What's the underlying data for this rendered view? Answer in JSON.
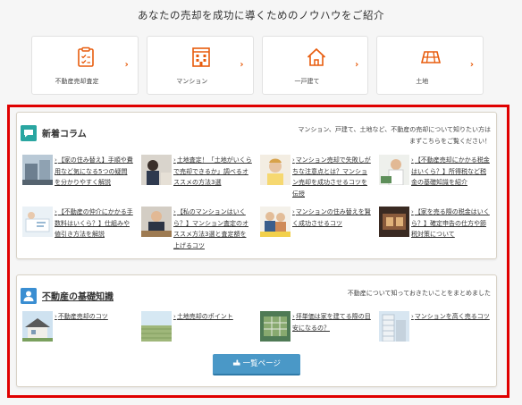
{
  "heading": "あなたの売却を成功に導くためのノウハウをご紹介",
  "categories": [
    {
      "label": "不動産売却査定",
      "icon": "clipboard-icon"
    },
    {
      "label": "マンション",
      "icon": "building-icon"
    },
    {
      "label": "一戸建て",
      "icon": "house-icon"
    },
    {
      "label": "土地",
      "icon": "land-grid-icon"
    }
  ],
  "chevron": "›",
  "sections": {
    "new_columns": {
      "title": "新着コラム",
      "description": "マンション、戸建て、土地など、不動産の売却について知りたい方はまずこちらをご覧ください！",
      "articles": [
        {
          "text": "【家の住み替え】手順や費用など気になる5つの疑問を分かりやすく解説"
        },
        {
          "text": "土地査定！「土地がいくらで売却できるか」調べるオススメの方法3選"
        },
        {
          "text": "マンション売却で失敗しがちな注意点とは？マンション売却を成功させるコツを伝授"
        },
        {
          "text": "【不動産売却にかかる税金はいくら？】所得税など税金の基礎知識を紹介"
        },
        {
          "text": "【不動産の仲介にかかる手数料はいくら？】仕組みや値引き方法を解説"
        },
        {
          "text": "【私のマンションはいくら？】マンション査定のオススメ方法3選と査定額を上げるコツ"
        },
        {
          "text": "マンションの住み替えを賢く成功させるコツ"
        },
        {
          "text": "【家を売る際の税金はいくら？】確定申告の仕方や節税対策について"
        }
      ]
    },
    "basics": {
      "title": "不動産の基礎知識",
      "description": "不動産について知っておきたいことをまとめました",
      "articles": [
        {
          "text": "不動産売却のコツ"
        },
        {
          "text": "土地売却のポイント"
        },
        {
          "text": "坪単価は家を建てる際の目安になるの？"
        },
        {
          "text": "マンションを高く売るコツ"
        }
      ]
    }
  },
  "list_button": {
    "label": "一覧ページ",
    "icon": "hand-pointer-icon"
  },
  "colors": {
    "accent_orange": "#e85c0d",
    "teal": "#2aa6a1",
    "blue": "#3a8ed2",
    "button": "#4a98c7",
    "highlight_red": "#e00000"
  }
}
